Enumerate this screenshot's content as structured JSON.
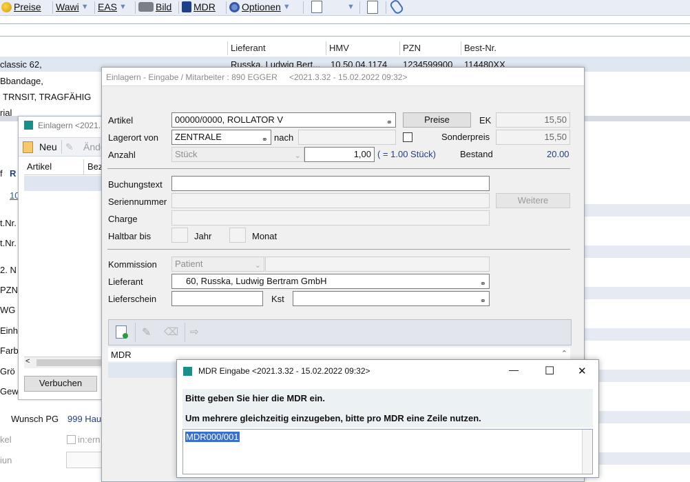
{
  "toolbar": {
    "items": [
      {
        "label": "Preise",
        "icon": "coin-icon",
        "has_menu": false
      },
      {
        "label": "Wawi",
        "icon": "",
        "has_menu": true
      },
      {
        "label": "EAS",
        "icon": "",
        "has_menu": true
      },
      {
        "label": "Bild",
        "icon": "camera-icon",
        "has_menu": false
      },
      {
        "label": "MDR",
        "icon": "lock-icon",
        "has_menu": false
      },
      {
        "label": "Optionen",
        "icon": "gear-icon",
        "has_menu": true
      }
    ]
  },
  "background": {
    "columns": [
      "Lieferant",
      "HMV",
      "PZN",
      "Best-Nr."
    ],
    "row1": {
      "artikel": "classic 62,",
      "lieferant": "Russka, Ludwig Bert...",
      "hmv": "10.50.04.1174",
      "pzn": "1234599900",
      "best_nr": "114480XX"
    },
    "lines": [
      "Bbandage,",
      "TRNSIT, TRAGFÄHIG",
      "rial"
    ],
    "left_labels": [
      "f",
      "t.Nr.",
      "t.Nr.",
      "2. N",
      "PZN",
      "WG",
      "Einh",
      "Farb",
      "Grö",
      "Gew"
    ],
    "left_value_r": "R",
    "left_value_num": "10",
    "wunsch_label": "Wunsch PG",
    "wunsch_value": "999 Hau",
    "intern_label": "in:ern",
    "faded1": "kel",
    "faded2": "iun"
  },
  "win2": {
    "title": "Einlagern <2021.3...",
    "new_label": "Neu",
    "edit_label": "Ände",
    "col_artikel": "Artikel",
    "col_bez": "Bez",
    "book_button": "Verbuchen"
  },
  "dialog": {
    "title": "Einlagern - Eingabe / Mitarbeiter : 890 EGGER",
    "title_version": "<2021.3.32 - 15.02.2022 09:32>",
    "artikel_label": "Artikel",
    "artikel_value": "00000/0000, ROLLATOR V",
    "preise_button": "Preise",
    "ek_label": "EK",
    "ek_value": "15,50",
    "lagerort_label": "Lagerort von",
    "lagerort_value": "ZENTRALE",
    "nach_label": "nach",
    "sonderpreis_label": "Sonderpreis",
    "sonderpreis_value": "15,50",
    "anzahl_label": "Anzahl",
    "einheit_value": "Stück",
    "anzahl_value": "1,00",
    "stueck_info": "( = 1.00 Stück)",
    "bestand_label": "Bestand",
    "bestand_value": "20.00",
    "buchungstext_label": "Buchungstext",
    "buchungstext_value": "",
    "seriennummer_label": "Seriennummer",
    "weitere_button": "Weitere",
    "charge_label": "Charge",
    "haltbar_label": "Haltbar bis",
    "jahr_label": "Jahr",
    "monat_label": "Monat",
    "kommission_label": "Kommission",
    "kommission_value": "Patient",
    "lieferant_label": "Lieferant",
    "lieferant_value": "60, Russka, Ludwig Bertram GmbH",
    "lieferschein_label": "Lieferschein",
    "lieferschein_value": "",
    "kst_label": "Kst",
    "kst_value": "",
    "list_first": "MDR"
  },
  "mdr": {
    "title": "MDR Eingabe <2021.3.32 - 15.02.2022 09:32>",
    "line1": "Bitte geben Sie hier die MDR ein.",
    "line2": "Um mehrere gleichzeitig einzugeben, bitte pro MDR eine Zeile nutzen.",
    "input_value": "MDR000/001",
    "minimize": "—",
    "maximize": "☐",
    "close": "✕"
  },
  "colors": {
    "accent": "#1f5fa8",
    "selection": "#3a6fd0",
    "toolbar": "#e9eef6"
  }
}
